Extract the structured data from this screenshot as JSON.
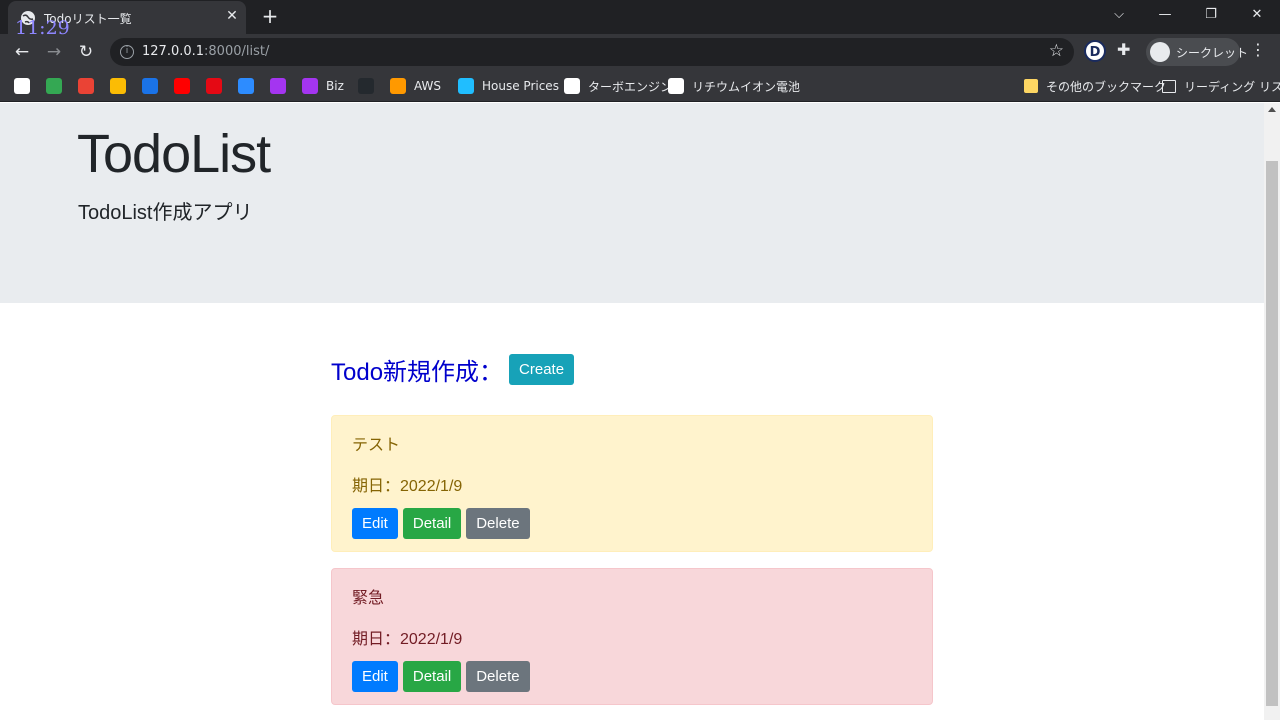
{
  "browser": {
    "tab_title": "Todoリスト一覧",
    "clock_overlay": "11:29",
    "url_host": "127.0.0.1",
    "url_rest": ":8000/list/",
    "incognito_label": "シークレット",
    "extension_letter": "D"
  },
  "bookmarks": {
    "items": [
      {
        "label": "",
        "icon": "google-icon",
        "color": "#ffffff"
      },
      {
        "label": "",
        "icon": "maps-icon",
        "color": "#34a853"
      },
      {
        "label": "",
        "icon": "gmail-icon",
        "color": "#ea4335"
      },
      {
        "label": "",
        "icon": "drive-icon",
        "color": "#fbbc04"
      },
      {
        "label": "",
        "icon": "outlook-icon",
        "color": "#1a73e8"
      },
      {
        "label": "",
        "icon": "youtube-icon",
        "color": "#ff0000"
      },
      {
        "label": "",
        "icon": "netflix-icon",
        "color": "#e50914"
      },
      {
        "label": "",
        "icon": "zoom-icon",
        "color": "#2d8cff"
      },
      {
        "label": "",
        "icon": "udemy-icon",
        "color": "#a435f0"
      },
      {
        "label": "Biz",
        "icon": "udemy-biz-icon",
        "color": "#a435f0"
      },
      {
        "label": "",
        "icon": "github-icon",
        "color": "#24292e"
      },
      {
        "label": "AWS",
        "icon": "aws-icon",
        "color": "#ff9900"
      },
      {
        "label": "House Prices",
        "icon": "kaggle-icon",
        "color": "#20beff"
      },
      {
        "label": "ターボエンジン",
        "icon": "notion-icon",
        "color": "#ffffff"
      },
      {
        "label": "リチウムイオン電池",
        "icon": "notion-icon",
        "color": "#ffffff"
      }
    ],
    "other_bookmarks": "その他のブックマーク",
    "reading_list": "リーディング リスト"
  },
  "page": {
    "title": "TodoList",
    "subtitle": "TodoList作成アプリ",
    "create_label": "Todo新規作成：",
    "create_button": "Create",
    "todos": [
      {
        "title": "テスト",
        "due": "期日：2022/1/9",
        "priority": "warning",
        "edit": "Edit",
        "detail": "Detail",
        "delete": "Delete"
      },
      {
        "title": "緊急",
        "due": "期日：2022/1/9",
        "priority": "danger",
        "edit": "Edit",
        "detail": "Detail",
        "delete": "Delete"
      }
    ]
  }
}
